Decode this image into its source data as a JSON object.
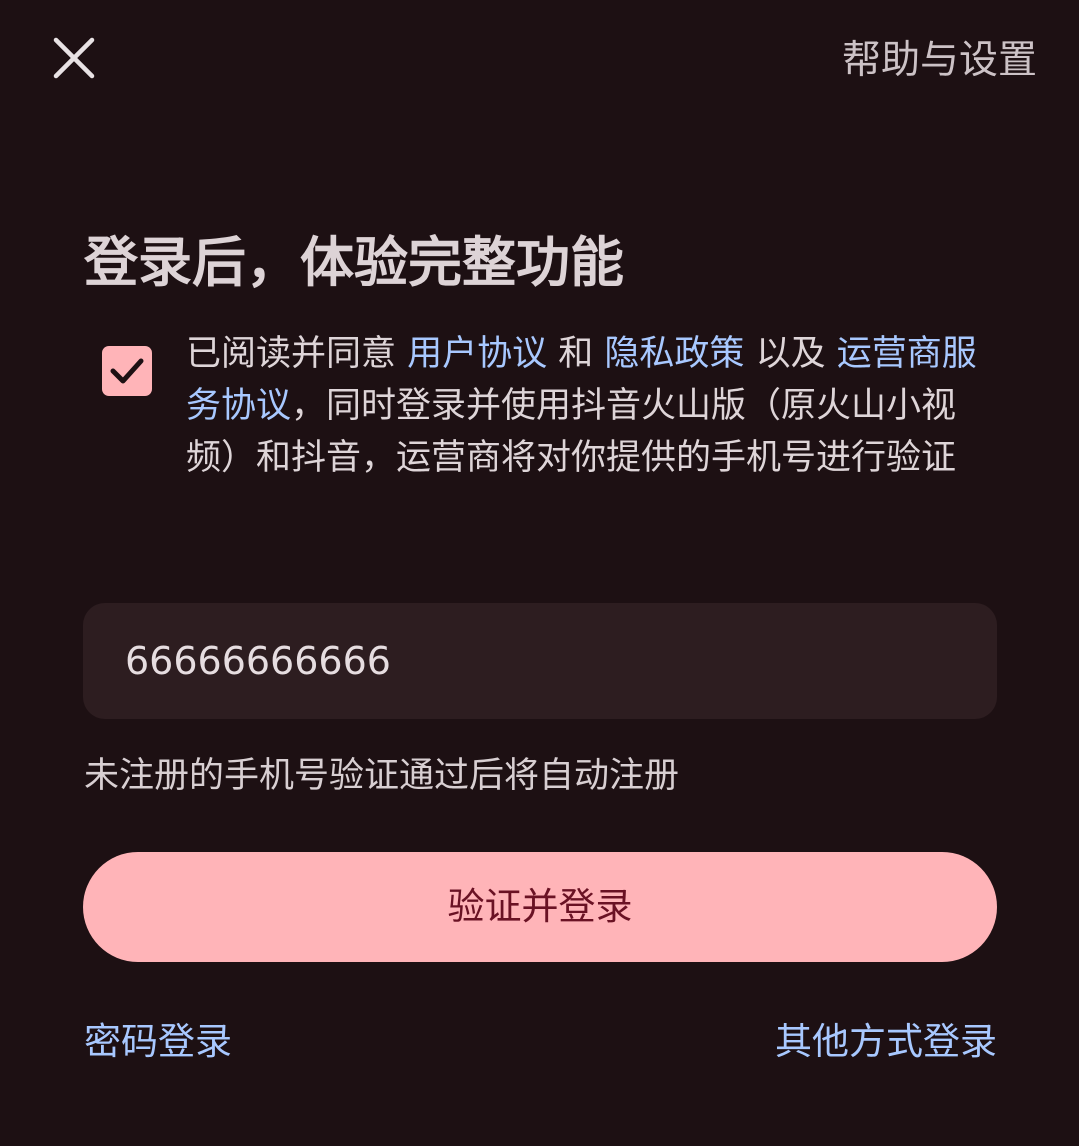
{
  "header": {
    "close_icon": "close-icon",
    "help_label": "帮助与设置"
  },
  "title": "登录后，体验完整功能",
  "agreement": {
    "checked": true,
    "check_icon": "checkmark-icon",
    "text_1": "已阅读并同意 ",
    "link_user_agreement": "用户协议",
    "text_2": " 和 ",
    "link_privacy_policy": "隐私政策",
    "text_3": " 以及 ",
    "link_carrier_service": "运营商服务协议",
    "text_4": "，同时登录并使用抖音火山版（原火山小视频）和抖音，运营商将对你提供的手机号进行验证"
  },
  "phone_input": {
    "value": "66666666666"
  },
  "hint": "未注册的手机号验证通过后将自动注册",
  "submit_label": "验证并登录",
  "footer": {
    "password_login": "密码登录",
    "other_login": "其他方式登录"
  },
  "colors": {
    "background": "#1d1013",
    "accent": "#ffb4b8",
    "link": "#a8c8ff",
    "button_text": "#6a1224",
    "input_bg": "#2d1d20"
  }
}
